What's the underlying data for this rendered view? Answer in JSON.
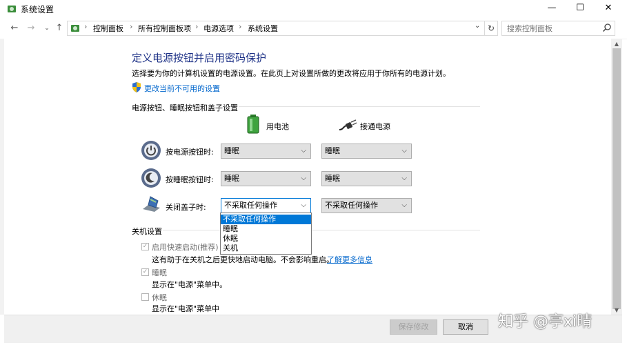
{
  "window": {
    "title": "系统设置",
    "controls": {
      "minimize": "—",
      "maximize": "☐",
      "close": "✕"
    }
  },
  "address": {
    "breadcrumbs": [
      "控制面板",
      "所有控制面板项",
      "电源选项",
      "系统设置"
    ],
    "search_placeholder": "搜索控制面板"
  },
  "main": {
    "heading": "定义电源按钮并启用密码保护",
    "description": "选择要为你的计算机设置的电源设置。在此页上对设置所做的更改将应用于你所有的电源计划。",
    "change_link": "更改当前不可用的设置",
    "section_buttons": "电源按钮、睡眠按钮和盖子设置",
    "col_battery": "用电池",
    "col_plugged": "接通电源",
    "rows": [
      {
        "label": "按电源按钮时:",
        "battery": "睡眠",
        "plugged": "睡眠"
      },
      {
        "label": "按睡眠按钮时:",
        "battery": "睡眠",
        "plugged": "睡眠"
      },
      {
        "label": "关闭盖子时:",
        "battery": "不采取任何操作",
        "plugged": "不采取任何操作"
      }
    ],
    "dropdown_options": [
      "不采取任何操作",
      "睡眠",
      "休眠",
      "关机"
    ],
    "dropdown_selected_index": 0,
    "section_shutdown": "关机设置",
    "shutdown": [
      {
        "label": "启用快速启动(推荐)",
        "checked": true,
        "desc": "这有助于在关机之后更快地启动电脑。不会影响重启。"
      },
      {
        "label": "睡眠",
        "checked": true,
        "desc": "显示在\"电源\"菜单中。"
      },
      {
        "label": "休眠",
        "checked": false,
        "desc": "显示在\"电源\"菜单中"
      }
    ],
    "learn_more": "了解更多信息"
  },
  "footer": {
    "save": "保存修改",
    "cancel": "取消"
  },
  "watermark": "知乎 @亭xi晴",
  "colors": {
    "heading": "#1e3287",
    "link": "#0066cc",
    "selected": "#0078d7"
  }
}
